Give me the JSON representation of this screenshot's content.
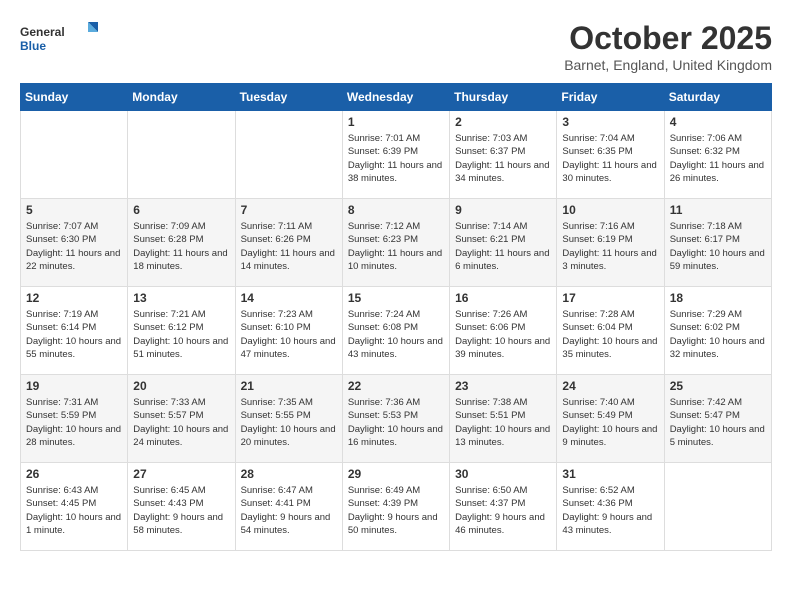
{
  "header": {
    "logo": {
      "general": "General",
      "blue": "Blue"
    },
    "title": "October 2025",
    "location": "Barnet, England, United Kingdom"
  },
  "weekdays": [
    "Sunday",
    "Monday",
    "Tuesday",
    "Wednesday",
    "Thursday",
    "Friday",
    "Saturday"
  ],
  "weeks": [
    [
      {
        "day": "",
        "info": ""
      },
      {
        "day": "",
        "info": ""
      },
      {
        "day": "",
        "info": ""
      },
      {
        "day": "1",
        "info": "Sunrise: 7:01 AM\nSunset: 6:39 PM\nDaylight: 11 hours\nand 38 minutes."
      },
      {
        "day": "2",
        "info": "Sunrise: 7:03 AM\nSunset: 6:37 PM\nDaylight: 11 hours\nand 34 minutes."
      },
      {
        "day": "3",
        "info": "Sunrise: 7:04 AM\nSunset: 6:35 PM\nDaylight: 11 hours\nand 30 minutes."
      },
      {
        "day": "4",
        "info": "Sunrise: 7:06 AM\nSunset: 6:32 PM\nDaylight: 11 hours\nand 26 minutes."
      }
    ],
    [
      {
        "day": "5",
        "info": "Sunrise: 7:07 AM\nSunset: 6:30 PM\nDaylight: 11 hours\nand 22 minutes."
      },
      {
        "day": "6",
        "info": "Sunrise: 7:09 AM\nSunset: 6:28 PM\nDaylight: 11 hours\nand 18 minutes."
      },
      {
        "day": "7",
        "info": "Sunrise: 7:11 AM\nSunset: 6:26 PM\nDaylight: 11 hours\nand 14 minutes."
      },
      {
        "day": "8",
        "info": "Sunrise: 7:12 AM\nSunset: 6:23 PM\nDaylight: 11 hours\nand 10 minutes."
      },
      {
        "day": "9",
        "info": "Sunrise: 7:14 AM\nSunset: 6:21 PM\nDaylight: 11 hours\nand 6 minutes."
      },
      {
        "day": "10",
        "info": "Sunrise: 7:16 AM\nSunset: 6:19 PM\nDaylight: 11 hours\nand 3 minutes."
      },
      {
        "day": "11",
        "info": "Sunrise: 7:18 AM\nSunset: 6:17 PM\nDaylight: 10 hours\nand 59 minutes."
      }
    ],
    [
      {
        "day": "12",
        "info": "Sunrise: 7:19 AM\nSunset: 6:14 PM\nDaylight: 10 hours\nand 55 minutes."
      },
      {
        "day": "13",
        "info": "Sunrise: 7:21 AM\nSunset: 6:12 PM\nDaylight: 10 hours\nand 51 minutes."
      },
      {
        "day": "14",
        "info": "Sunrise: 7:23 AM\nSunset: 6:10 PM\nDaylight: 10 hours\nand 47 minutes."
      },
      {
        "day": "15",
        "info": "Sunrise: 7:24 AM\nSunset: 6:08 PM\nDaylight: 10 hours\nand 43 minutes."
      },
      {
        "day": "16",
        "info": "Sunrise: 7:26 AM\nSunset: 6:06 PM\nDaylight: 10 hours\nand 39 minutes."
      },
      {
        "day": "17",
        "info": "Sunrise: 7:28 AM\nSunset: 6:04 PM\nDaylight: 10 hours\nand 35 minutes."
      },
      {
        "day": "18",
        "info": "Sunrise: 7:29 AM\nSunset: 6:02 PM\nDaylight: 10 hours\nand 32 minutes."
      }
    ],
    [
      {
        "day": "19",
        "info": "Sunrise: 7:31 AM\nSunset: 5:59 PM\nDaylight: 10 hours\nand 28 minutes."
      },
      {
        "day": "20",
        "info": "Sunrise: 7:33 AM\nSunset: 5:57 PM\nDaylight: 10 hours\nand 24 minutes."
      },
      {
        "day": "21",
        "info": "Sunrise: 7:35 AM\nSunset: 5:55 PM\nDaylight: 10 hours\nand 20 minutes."
      },
      {
        "day": "22",
        "info": "Sunrise: 7:36 AM\nSunset: 5:53 PM\nDaylight: 10 hours\nand 16 minutes."
      },
      {
        "day": "23",
        "info": "Sunrise: 7:38 AM\nSunset: 5:51 PM\nDaylight: 10 hours\nand 13 minutes."
      },
      {
        "day": "24",
        "info": "Sunrise: 7:40 AM\nSunset: 5:49 PM\nDaylight: 10 hours\nand 9 minutes."
      },
      {
        "day": "25",
        "info": "Sunrise: 7:42 AM\nSunset: 5:47 PM\nDaylight: 10 hours\nand 5 minutes."
      }
    ],
    [
      {
        "day": "26",
        "info": "Sunrise: 6:43 AM\nSunset: 4:45 PM\nDaylight: 10 hours\nand 1 minute."
      },
      {
        "day": "27",
        "info": "Sunrise: 6:45 AM\nSunset: 4:43 PM\nDaylight: 9 hours\nand 58 minutes."
      },
      {
        "day": "28",
        "info": "Sunrise: 6:47 AM\nSunset: 4:41 PM\nDaylight: 9 hours\nand 54 minutes."
      },
      {
        "day": "29",
        "info": "Sunrise: 6:49 AM\nSunset: 4:39 PM\nDaylight: 9 hours\nand 50 minutes."
      },
      {
        "day": "30",
        "info": "Sunrise: 6:50 AM\nSunset: 4:37 PM\nDaylight: 9 hours\nand 46 minutes."
      },
      {
        "day": "31",
        "info": "Sunrise: 6:52 AM\nSunset: 4:36 PM\nDaylight: 9 hours\nand 43 minutes."
      },
      {
        "day": "",
        "info": ""
      }
    ]
  ]
}
